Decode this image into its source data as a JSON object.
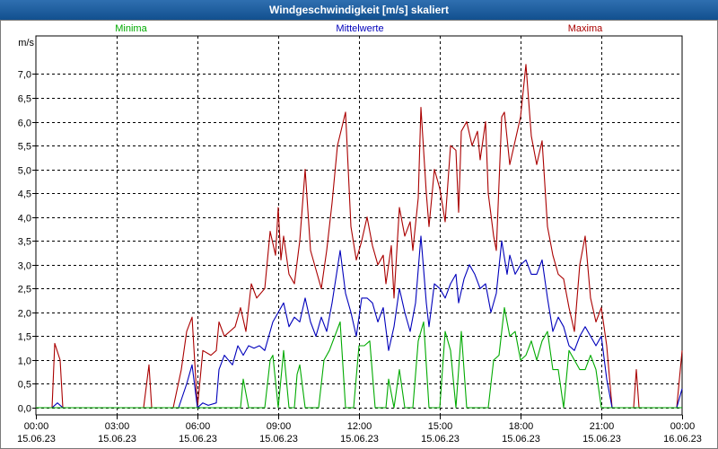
{
  "window": {
    "title": "Windgeschwindigkeit [m/s] skaliert"
  },
  "colors": {
    "minima": "#00aa00",
    "mittelwerte": "#0000bb",
    "maxima": "#aa0000",
    "grid": "#000000"
  },
  "chart_data": {
    "type": "line",
    "title": "Windgeschwindigkeit [m/s] skaliert",
    "ylabel": "m/s",
    "xlabel": "",
    "ylim": [
      -0.15,
      7.8
    ],
    "xlim": [
      0,
      24
    ],
    "grid": true,
    "legend": [
      "Minima",
      "Mittelwerte",
      "Maxima"
    ],
    "yticks": [
      {
        "v": 0.0,
        "label": "0,0"
      },
      {
        "v": 0.5,
        "label": "0,5"
      },
      {
        "v": 1.0,
        "label": "1,0"
      },
      {
        "v": 1.5,
        "label": "1,5"
      },
      {
        "v": 2.0,
        "label": "2,0"
      },
      {
        "v": 2.5,
        "label": "2,5"
      },
      {
        "v": 3.0,
        "label": "3,0"
      },
      {
        "v": 3.5,
        "label": "3,5"
      },
      {
        "v": 4.0,
        "label": "4,0"
      },
      {
        "v": 4.5,
        "label": "4,5"
      },
      {
        "v": 5.0,
        "label": "5,0"
      },
      {
        "v": 5.5,
        "label": "5,5"
      },
      {
        "v": 6.0,
        "label": "6,0"
      },
      {
        "v": 6.5,
        "label": "6,5"
      },
      {
        "v": 7.0,
        "label": "7,0"
      }
    ],
    "xticks": [
      {
        "v": 0,
        "time": "00:00",
        "date": "15.06.23"
      },
      {
        "v": 3,
        "time": "03:00",
        "date": "15.06.23"
      },
      {
        "v": 6,
        "time": "06:00",
        "date": "15.06.23"
      },
      {
        "v": 9,
        "time": "09:00",
        "date": "15.06.23"
      },
      {
        "v": 12,
        "time": "12:00",
        "date": "15.06.23"
      },
      {
        "v": 15,
        "time": "15:00",
        "date": "15.06.23"
      },
      {
        "v": 18,
        "time": "18:00",
        "date": "15.06.23"
      },
      {
        "v": 21,
        "time": "21:00",
        "date": "15.06.23"
      },
      {
        "v": 24,
        "time": "00:00",
        "date": "16.06.23"
      }
    ],
    "series": [
      {
        "name": "Maxima",
        "color": "#aa0000",
        "points": [
          [
            0,
            0
          ],
          [
            0.6,
            0
          ],
          [
            0.7,
            1.35
          ],
          [
            0.9,
            1.0
          ],
          [
            1.0,
            0
          ],
          [
            4.0,
            0
          ],
          [
            4.2,
            0.9
          ],
          [
            4.3,
            0
          ],
          [
            5.1,
            0
          ],
          [
            5.4,
            0.8
          ],
          [
            5.6,
            1.6
          ],
          [
            5.8,
            1.9
          ],
          [
            6.0,
            0
          ],
          [
            6.2,
            1.2
          ],
          [
            6.5,
            1.1
          ],
          [
            6.7,
            1.2
          ],
          [
            6.8,
            1.8
          ],
          [
            7.0,
            1.5
          ],
          [
            7.2,
            1.6
          ],
          [
            7.4,
            1.7
          ],
          [
            7.6,
            2.1
          ],
          [
            7.8,
            1.6
          ],
          [
            8.0,
            2.6
          ],
          [
            8.2,
            2.3
          ],
          [
            8.5,
            2.5
          ],
          [
            8.7,
            3.7
          ],
          [
            8.9,
            3.2
          ],
          [
            9.0,
            4.2
          ],
          [
            9.1,
            3.1
          ],
          [
            9.2,
            3.6
          ],
          [
            9.4,
            2.8
          ],
          [
            9.6,
            2.6
          ],
          [
            9.8,
            3.5
          ],
          [
            10.0,
            5.0
          ],
          [
            10.2,
            3.3
          ],
          [
            10.4,
            2.9
          ],
          [
            10.6,
            2.5
          ],
          [
            10.8,
            3.3
          ],
          [
            11.0,
            4.3
          ],
          [
            11.2,
            5.5
          ],
          [
            11.5,
            6.2
          ],
          [
            11.7,
            3.8
          ],
          [
            11.9,
            3.1
          ],
          [
            12.1,
            3.5
          ],
          [
            12.3,
            4.0
          ],
          [
            12.5,
            3.4
          ],
          [
            12.7,
            3.0
          ],
          [
            12.9,
            3.2
          ],
          [
            13.0,
            2.6
          ],
          [
            13.2,
            3.4
          ],
          [
            13.3,
            2.3
          ],
          [
            13.5,
            4.2
          ],
          [
            13.7,
            3.6
          ],
          [
            13.9,
            3.9
          ],
          [
            14.0,
            3.3
          ],
          [
            14.2,
            4.4
          ],
          [
            14.3,
            6.3
          ],
          [
            14.5,
            4.5
          ],
          [
            14.6,
            3.8
          ],
          [
            14.8,
            5.0
          ],
          [
            15.0,
            4.6
          ],
          [
            15.2,
            3.9
          ],
          [
            15.4,
            5.5
          ],
          [
            15.6,
            5.4
          ],
          [
            15.7,
            4.1
          ],
          [
            15.8,
            5.8
          ],
          [
            16.0,
            6.0
          ],
          [
            16.2,
            5.5
          ],
          [
            16.4,
            5.8
          ],
          [
            16.5,
            5.2
          ],
          [
            16.7,
            6.0
          ],
          [
            16.8,
            4.5
          ],
          [
            17.0,
            3.6
          ],
          [
            17.1,
            3.3
          ],
          [
            17.3,
            6.1
          ],
          [
            17.4,
            6.2
          ],
          [
            17.6,
            5.1
          ],
          [
            17.8,
            5.6
          ],
          [
            18.0,
            6.1
          ],
          [
            18.2,
            7.2
          ],
          [
            18.4,
            5.7
          ],
          [
            18.6,
            5.1
          ],
          [
            18.8,
            5.6
          ],
          [
            19.0,
            3.8
          ],
          [
            19.2,
            3.2
          ],
          [
            19.4,
            2.8
          ],
          [
            19.6,
            2.7
          ],
          [
            19.8,
            2.1
          ],
          [
            20.0,
            1.6
          ],
          [
            20.2,
            3.0
          ],
          [
            20.4,
            3.6
          ],
          [
            20.6,
            2.3
          ],
          [
            20.8,
            1.8
          ],
          [
            21.0,
            2.1
          ],
          [
            21.2,
            1.3
          ],
          [
            21.4,
            0
          ],
          [
            22.2,
            0
          ],
          [
            22.3,
            0.8
          ],
          [
            22.4,
            0
          ],
          [
            23.8,
            0
          ],
          [
            24.0,
            1.2
          ]
        ]
      },
      {
        "name": "Mittelwerte",
        "color": "#0000bb",
        "points": [
          [
            0,
            0
          ],
          [
            0.6,
            0
          ],
          [
            0.8,
            0.1
          ],
          [
            1.0,
            0
          ],
          [
            5.3,
            0
          ],
          [
            5.6,
            0.5
          ],
          [
            5.8,
            0.9
          ],
          [
            6.0,
            0
          ],
          [
            6.2,
            0.1
          ],
          [
            6.4,
            0.05
          ],
          [
            6.7,
            0.1
          ],
          [
            6.8,
            0.8
          ],
          [
            7.0,
            1.1
          ],
          [
            7.3,
            0.9
          ],
          [
            7.5,
            1.3
          ],
          [
            7.7,
            1.1
          ],
          [
            7.9,
            1.3
          ],
          [
            8.1,
            1.25
          ],
          [
            8.3,
            1.3
          ],
          [
            8.5,
            1.2
          ],
          [
            8.8,
            1.8
          ],
          [
            9.0,
            2.0
          ],
          [
            9.2,
            2.2
          ],
          [
            9.4,
            1.7
          ],
          [
            9.6,
            1.9
          ],
          [
            9.8,
            1.8
          ],
          [
            10.0,
            2.3
          ],
          [
            10.2,
            1.8
          ],
          [
            10.4,
            1.5
          ],
          [
            10.6,
            1.9
          ],
          [
            10.8,
            1.6
          ],
          [
            11.0,
            2.2
          ],
          [
            11.3,
            3.3
          ],
          [
            11.5,
            2.4
          ],
          [
            11.7,
            2.0
          ],
          [
            11.9,
            1.5
          ],
          [
            12.1,
            2.3
          ],
          [
            12.3,
            2.3
          ],
          [
            12.5,
            2.2
          ],
          [
            12.7,
            1.8
          ],
          [
            12.9,
            2.1
          ],
          [
            13.1,
            1.2
          ],
          [
            13.3,
            1.7
          ],
          [
            13.5,
            2.5
          ],
          [
            13.7,
            2.0
          ],
          [
            13.9,
            1.6
          ],
          [
            14.1,
            2.2
          ],
          [
            14.3,
            3.6
          ],
          [
            14.5,
            2.2
          ],
          [
            14.6,
            1.7
          ],
          [
            14.8,
            2.6
          ],
          [
            15.0,
            2.5
          ],
          [
            15.2,
            2.3
          ],
          [
            15.4,
            2.6
          ],
          [
            15.6,
            2.8
          ],
          [
            15.7,
            2.2
          ],
          [
            15.9,
            2.7
          ],
          [
            16.1,
            3.0
          ],
          [
            16.3,
            2.8
          ],
          [
            16.5,
            2.5
          ],
          [
            16.7,
            2.6
          ],
          [
            16.9,
            2.0
          ],
          [
            17.1,
            2.4
          ],
          [
            17.3,
            3.5
          ],
          [
            17.5,
            2.8
          ],
          [
            17.6,
            3.2
          ],
          [
            17.8,
            2.8
          ],
          [
            18.0,
            3.0
          ],
          [
            18.2,
            3.1
          ],
          [
            18.4,
            2.8
          ],
          [
            18.6,
            2.8
          ],
          [
            18.8,
            3.1
          ],
          [
            19.0,
            2.3
          ],
          [
            19.2,
            1.6
          ],
          [
            19.4,
            1.9
          ],
          [
            19.6,
            1.7
          ],
          [
            19.8,
            1.3
          ],
          [
            20.0,
            1.2
          ],
          [
            20.2,
            1.5
          ],
          [
            20.4,
            1.7
          ],
          [
            20.6,
            1.5
          ],
          [
            20.8,
            1.3
          ],
          [
            21.0,
            1.5
          ],
          [
            21.2,
            0.6
          ],
          [
            21.4,
            0
          ],
          [
            23.8,
            0
          ],
          [
            24.0,
            0.4
          ]
        ]
      },
      {
        "name": "Minima",
        "color": "#00aa00",
        "points": [
          [
            0,
            0
          ],
          [
            7.6,
            0
          ],
          [
            7.7,
            0.6
          ],
          [
            7.9,
            0
          ],
          [
            8.5,
            0
          ],
          [
            8.7,
            1.0
          ],
          [
            8.8,
            1.1
          ],
          [
            9.0,
            0
          ],
          [
            9.2,
            1.2
          ],
          [
            9.4,
            0
          ],
          [
            9.6,
            0
          ],
          [
            9.7,
            0.7
          ],
          [
            9.8,
            0.9
          ],
          [
            10.0,
            0
          ],
          [
            10.5,
            0
          ],
          [
            10.7,
            1.0
          ],
          [
            10.9,
            1.2
          ],
          [
            11.1,
            1.5
          ],
          [
            11.3,
            1.8
          ],
          [
            11.5,
            0
          ],
          [
            11.8,
            0
          ],
          [
            12.0,
            1.3
          ],
          [
            12.2,
            1.3
          ],
          [
            12.4,
            1.4
          ],
          [
            12.6,
            0
          ],
          [
            13.0,
            0
          ],
          [
            13.1,
            0.6
          ],
          [
            13.3,
            0
          ],
          [
            13.5,
            0.8
          ],
          [
            13.7,
            0
          ],
          [
            14.0,
            0
          ],
          [
            14.2,
            1.4
          ],
          [
            14.4,
            1.8
          ],
          [
            14.6,
            0
          ],
          [
            15.0,
            0
          ],
          [
            15.2,
            1.6
          ],
          [
            15.4,
            1.2
          ],
          [
            15.6,
            0
          ],
          [
            15.8,
            1.6
          ],
          [
            16.0,
            0
          ],
          [
            16.8,
            0
          ],
          [
            17.0,
            1.0
          ],
          [
            17.2,
            1.1
          ],
          [
            17.4,
            2.1
          ],
          [
            17.6,
            1.5
          ],
          [
            17.8,
            1.6
          ],
          [
            18.0,
            1.0
          ],
          [
            18.2,
            1.1
          ],
          [
            18.4,
            1.4
          ],
          [
            18.6,
            1.0
          ],
          [
            18.8,
            1.4
          ],
          [
            19.0,
            1.6
          ],
          [
            19.2,
            0.8
          ],
          [
            19.4,
            0.8
          ],
          [
            19.6,
            0
          ],
          [
            19.8,
            1.2
          ],
          [
            20.0,
            1.0
          ],
          [
            20.2,
            0.8
          ],
          [
            20.4,
            0.8
          ],
          [
            20.6,
            1.1
          ],
          [
            20.8,
            0.8
          ],
          [
            21.0,
            0
          ],
          [
            23.8,
            0
          ],
          [
            24.0,
            0
          ]
        ]
      }
    ]
  }
}
